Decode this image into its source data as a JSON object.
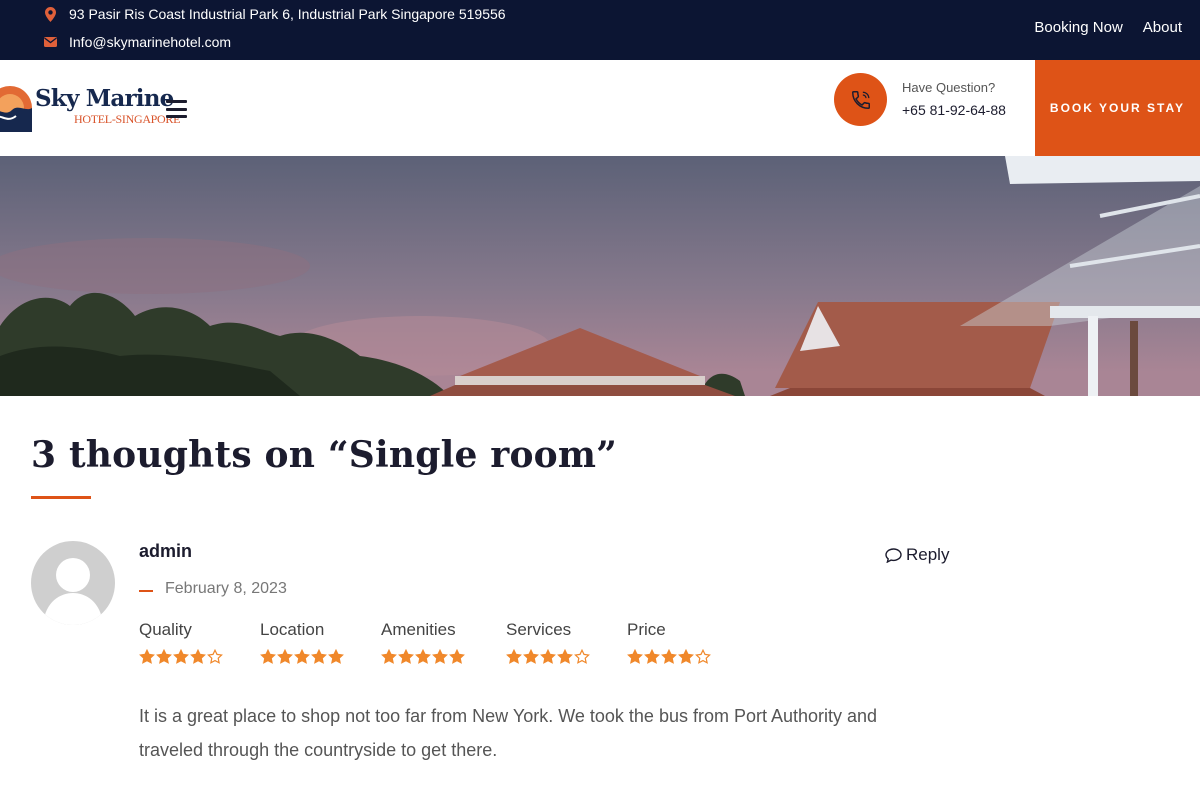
{
  "topbar": {
    "address": "93 Pasir Ris Coast Industrial Park 6, Industrial Park Singapore 519556",
    "email": "Info@skymarinehotel.com",
    "nav": [
      {
        "label": "Booking Now"
      },
      {
        "label": "About"
      }
    ]
  },
  "header": {
    "logo_name": "Sky Marine",
    "logo_sub": "HOTEL-SINGAPORE",
    "question": "Have Question?",
    "phone": "+65 81-92-64-88",
    "book_button": "BOOK YOUR STAY"
  },
  "comments": {
    "title": "3 thoughts on “Single room”",
    "items": [
      {
        "author": "admin",
        "date": "February 8, 2023",
        "reply_label": "Reply",
        "ratings": [
          {
            "label": "Quality",
            "stars": 4,
            "max": 5
          },
          {
            "label": "Location",
            "stars": 5,
            "max": 5
          },
          {
            "label": "Amenities",
            "stars": 5,
            "max": 5
          },
          {
            "label": "Services",
            "stars": 4,
            "max": 5
          },
          {
            "label": "Price",
            "stars": 4,
            "max": 5
          }
        ],
        "text": "It is a great place to shop not too far from New York. We took the bus from Port Authority and traveled through the countryside to get there."
      }
    ]
  },
  "colors": {
    "accent": "#de5317",
    "navy": "#0c1533",
    "star": "#f0882b"
  },
  "icons": {
    "address": "map-pin-icon",
    "email": "envelope-icon",
    "phone": "phone-icon",
    "menu": "hamburger-icon",
    "reply": "speech-bubble-icon",
    "rating": "star-icon"
  }
}
